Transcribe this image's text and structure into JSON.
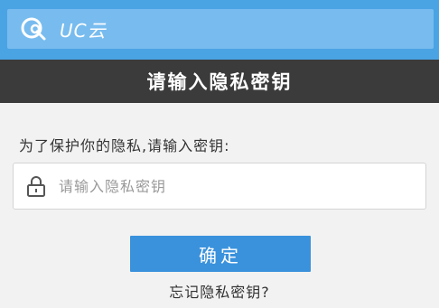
{
  "brand": {
    "logo_icon": "uc-cloud-logo-icon",
    "name": "UC云"
  },
  "header": {
    "title": "请输入隐私密钥"
  },
  "form": {
    "prompt": "为了保护你的隐私,请输入密钥:",
    "lock_icon": "lock-icon",
    "key_input": {
      "value": "",
      "placeholder": "请输入隐私密钥"
    },
    "confirm_label": "确定",
    "forgot_link": "忘记隐私密钥?"
  },
  "colors": {
    "topbar": "#4aa3e3",
    "brand_bar": "#78bcef",
    "titlebar": "#3b3b3b",
    "button": "#3a92dc",
    "background": "#f2f2f2"
  }
}
